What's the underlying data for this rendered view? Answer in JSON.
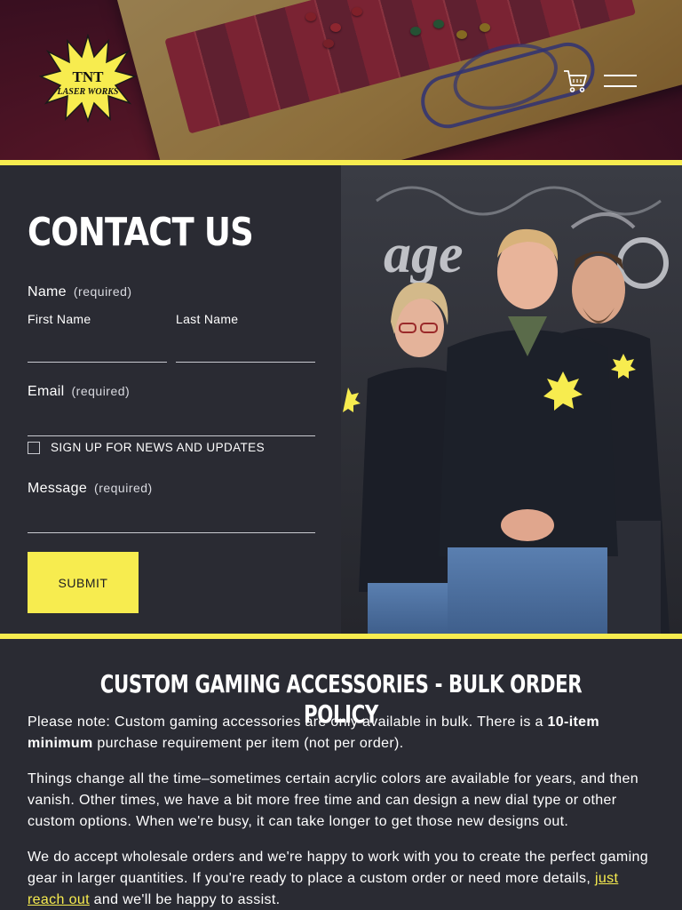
{
  "brand": {
    "logo_line1": "TNT",
    "logo_line2": "LASER WORKS"
  },
  "header": {
    "cart_icon": "cart-icon",
    "menu_icon": "hamburger-menu-icon"
  },
  "colors": {
    "accent": "#f7ec4f",
    "background": "#2a2b33",
    "text": "#ffffff"
  },
  "contact": {
    "title": "CONTACT US",
    "name_label": "Name",
    "name_required": "(required)",
    "first_name_label": "First Name",
    "first_name_value": "",
    "last_name_label": "Last Name",
    "last_name_value": "",
    "email_label": "Email",
    "email_required": "(required)",
    "email_value": "",
    "newsletter_label": "SIGN UP FOR NEWS AND UPDATES",
    "newsletter_checked": false,
    "message_label": "Message",
    "message_required": "(required)",
    "message_value": "",
    "submit_label": "SUBMIT",
    "photo_banner_text": "age"
  },
  "policy": {
    "title": "CUSTOM GAMING ACCESSORIES - BULK ORDER POLICY",
    "p1_before": "Please note: Custom gaming accessories are only available in bulk. There is a ",
    "p1_bold": "10-item minimum",
    "p1_after": " purchase requirement per item (not per order).",
    "p2": "Things change all the time–sometimes certain acrylic colors are available for years, and then vanish. Other times, we have a bit more free time and can design a new dial type or other custom options. When we're busy, it can take longer to get those new designs out.",
    "p3_before": "We do accept wholesale orders and we're happy to work with you to create the perfect gaming gear in larger quantities. If you're ready to place a custom order or need more details, ",
    "p3_link": "just reach out",
    "p3_after": " and we'll be happy to assist."
  }
}
